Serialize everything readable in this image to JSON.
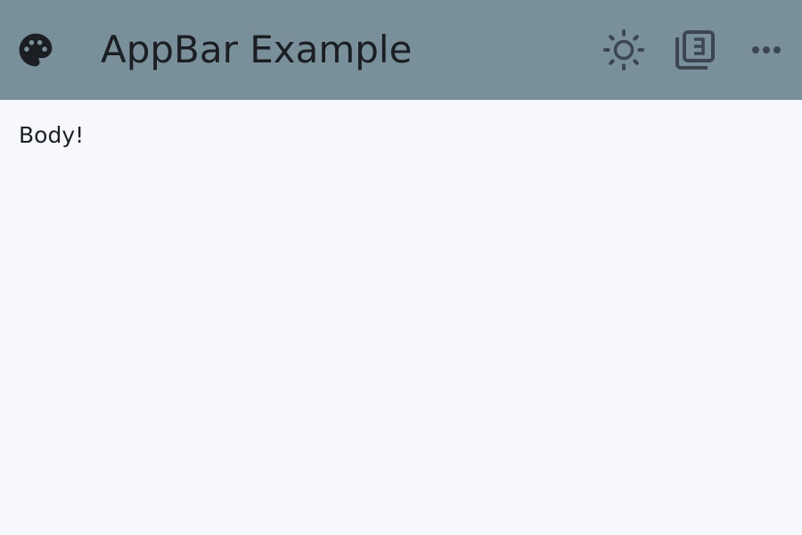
{
  "app_bar": {
    "title": "AppBar Example",
    "background_color": "#798f99",
    "leading_icon": "palette-icon",
    "actions": [
      {
        "icon": "brightness-icon"
      },
      {
        "icon": "filter-3-icon"
      },
      {
        "icon": "more-horizontal-icon"
      }
    ]
  },
  "body": {
    "text": "Body!",
    "background_color": "#f7f8fe"
  }
}
